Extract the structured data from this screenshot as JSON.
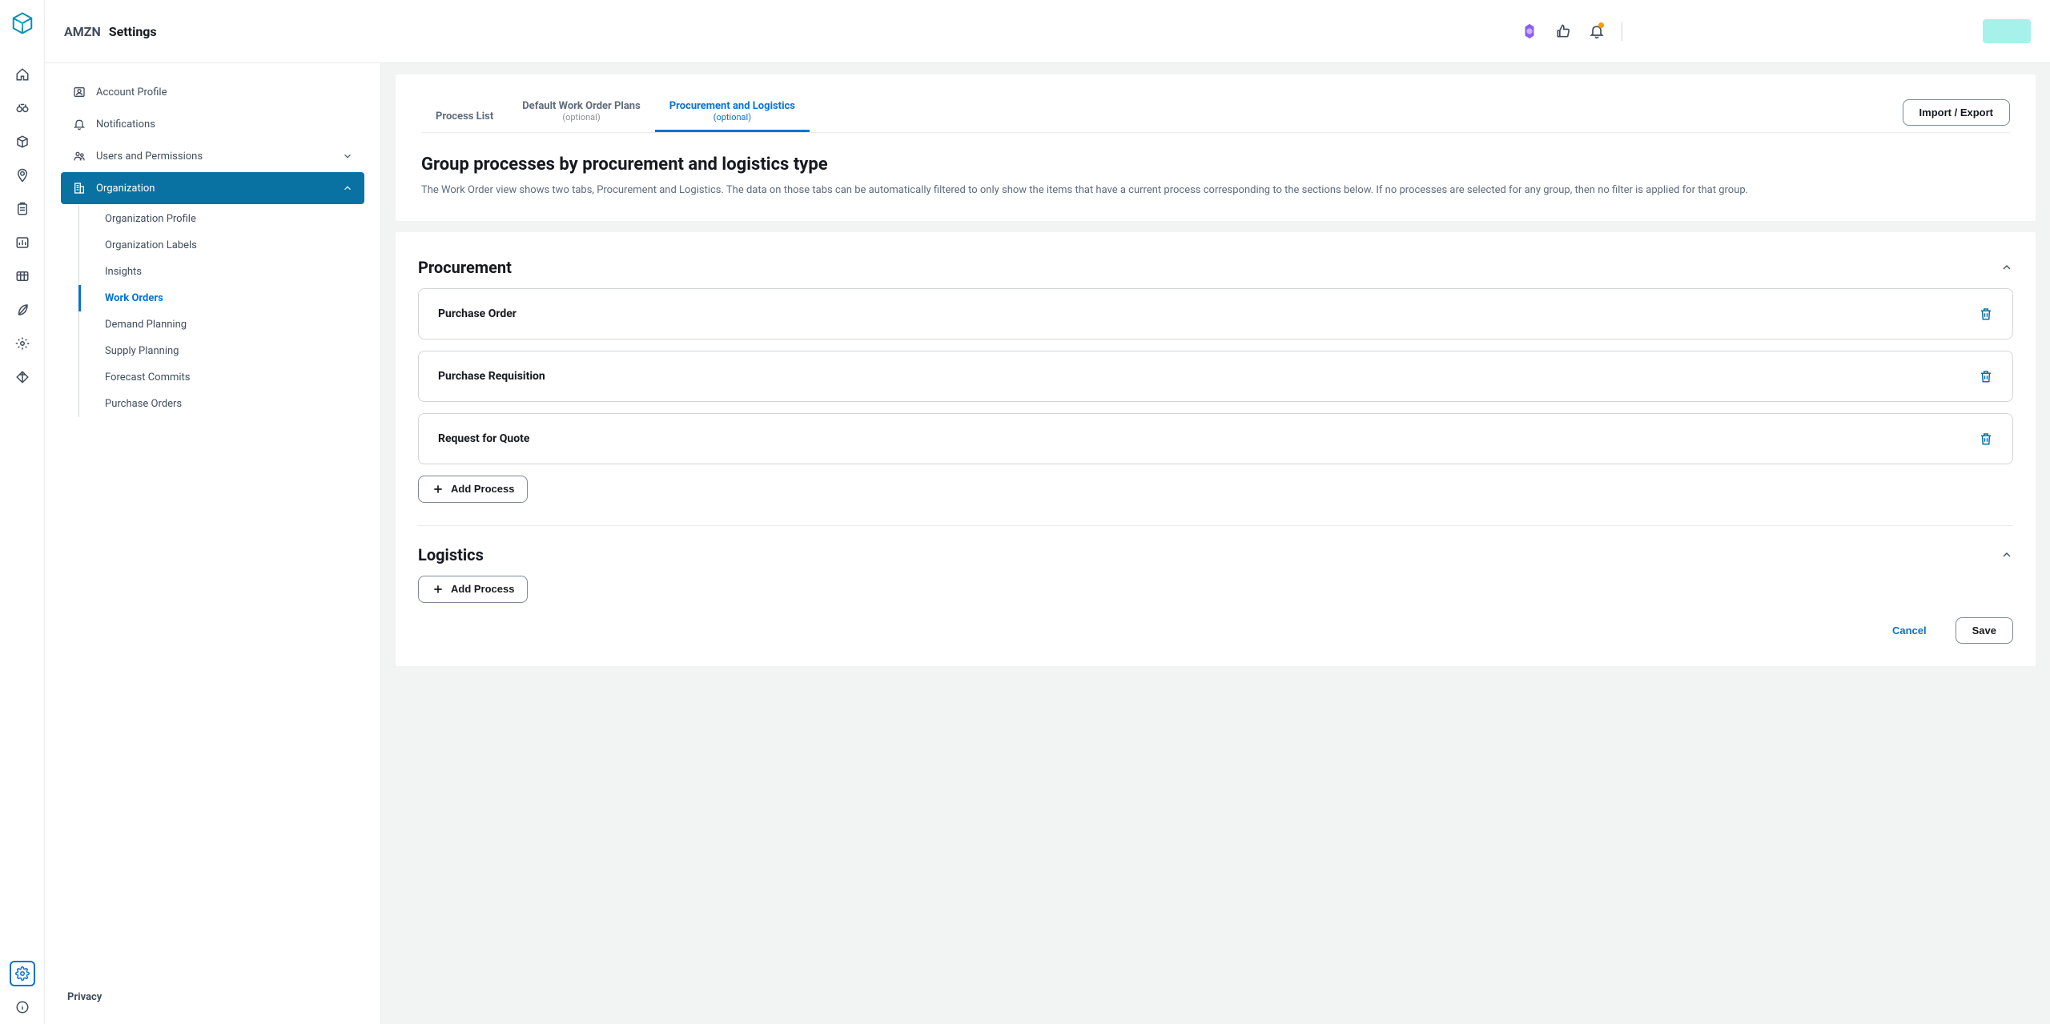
{
  "header": {
    "org_code": "AMZN",
    "page_name": "Settings"
  },
  "sidebar": {
    "nav": {
      "account_profile": "Account Profile",
      "notifications": "Notifications",
      "users_permissions": "Users and Permissions",
      "organization": "Organization"
    },
    "org_sub": {
      "organization_profile": "Organization Profile",
      "organization_labels": "Organization Labels",
      "insights": "Insights",
      "work_orders": "Work Orders",
      "demand_planning": "Demand Planning",
      "supply_planning": "Supply Planning",
      "forecast_commits": "Forecast Commits",
      "purchase_orders": "Purchase Orders"
    },
    "privacy": "Privacy"
  },
  "tabs": {
    "process_list": "Process List",
    "default_wo_plans": "Default Work Order Plans",
    "procurement_logistics": "Procurement and Logistics",
    "optional": "(optional)"
  },
  "actions": {
    "import_export": "Import / Export",
    "add_process": "Add Process",
    "cancel": "Cancel",
    "save": "Save"
  },
  "content": {
    "title": "Group processes by procurement and logistics type",
    "description": "The Work Order view shows two tabs, Procurement and Logistics. The data on those tabs can be automatically filtered to only show the items that have a current process corresponding to the sections below. If no processes are selected for any group, then no filter is applied for that group."
  },
  "groups": {
    "procurement": {
      "title": "Procurement",
      "items": [
        {
          "name": "Purchase Order"
        },
        {
          "name": "Purchase Requisition"
        },
        {
          "name": "Request for Quote"
        }
      ]
    },
    "logistics": {
      "title": "Logistics"
    }
  }
}
